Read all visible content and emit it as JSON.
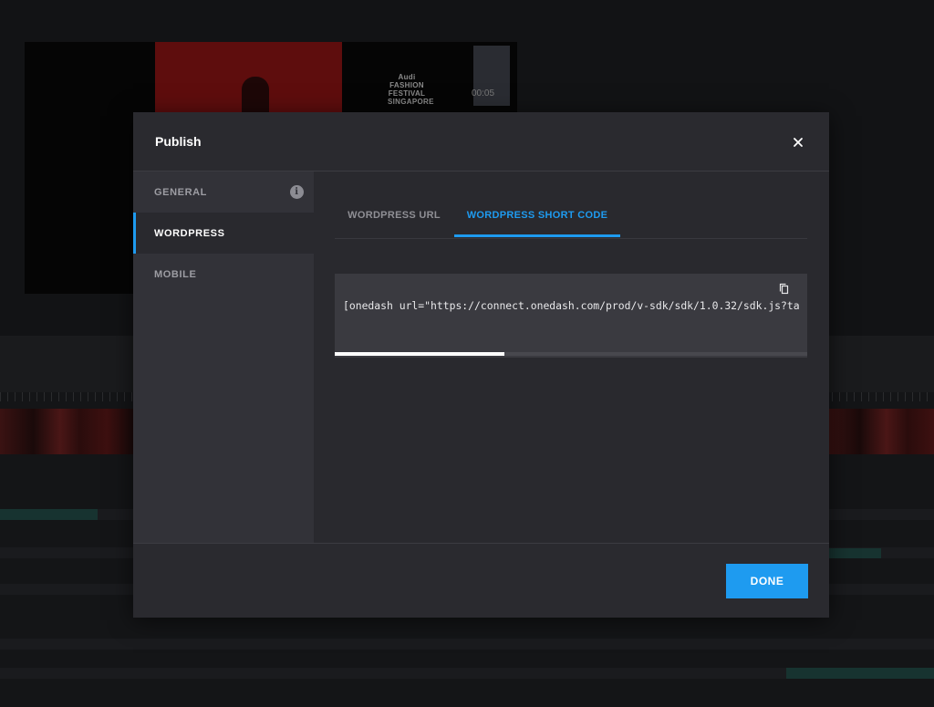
{
  "background": {
    "preview_logo_text": "Audi FASHION FESTIVAL SINGAPORE",
    "preview_timestamp": "00:05"
  },
  "modal": {
    "title": "Publish",
    "close_icon": "close-icon",
    "sidebar": {
      "items": [
        {
          "label": "GENERAL",
          "icon": "info-icon",
          "icon_glyph": "i",
          "active": false
        },
        {
          "label": "WORDPRESS",
          "active": true
        },
        {
          "label": "MOBILE",
          "active": false
        }
      ]
    },
    "tabs": [
      {
        "label": "WORDPRESS URL",
        "active": false
      },
      {
        "label": "WORDPRESS SHORT CODE",
        "active": true
      }
    ],
    "code": {
      "text": "[onedash url=\"https://connect.onedash.com/prod/v-sdk/sdk/1.0.32/sdk.js?ta",
      "copy_icon": "copy-icon",
      "scroll_position_fraction": 0.36
    },
    "footer": {
      "done_label": "DONE"
    }
  },
  "colors": {
    "accent": "#1e9bf0",
    "modal_bg": "#2a2a2f",
    "sidebar_bg": "#323238",
    "code_bg": "#3a3a40"
  }
}
